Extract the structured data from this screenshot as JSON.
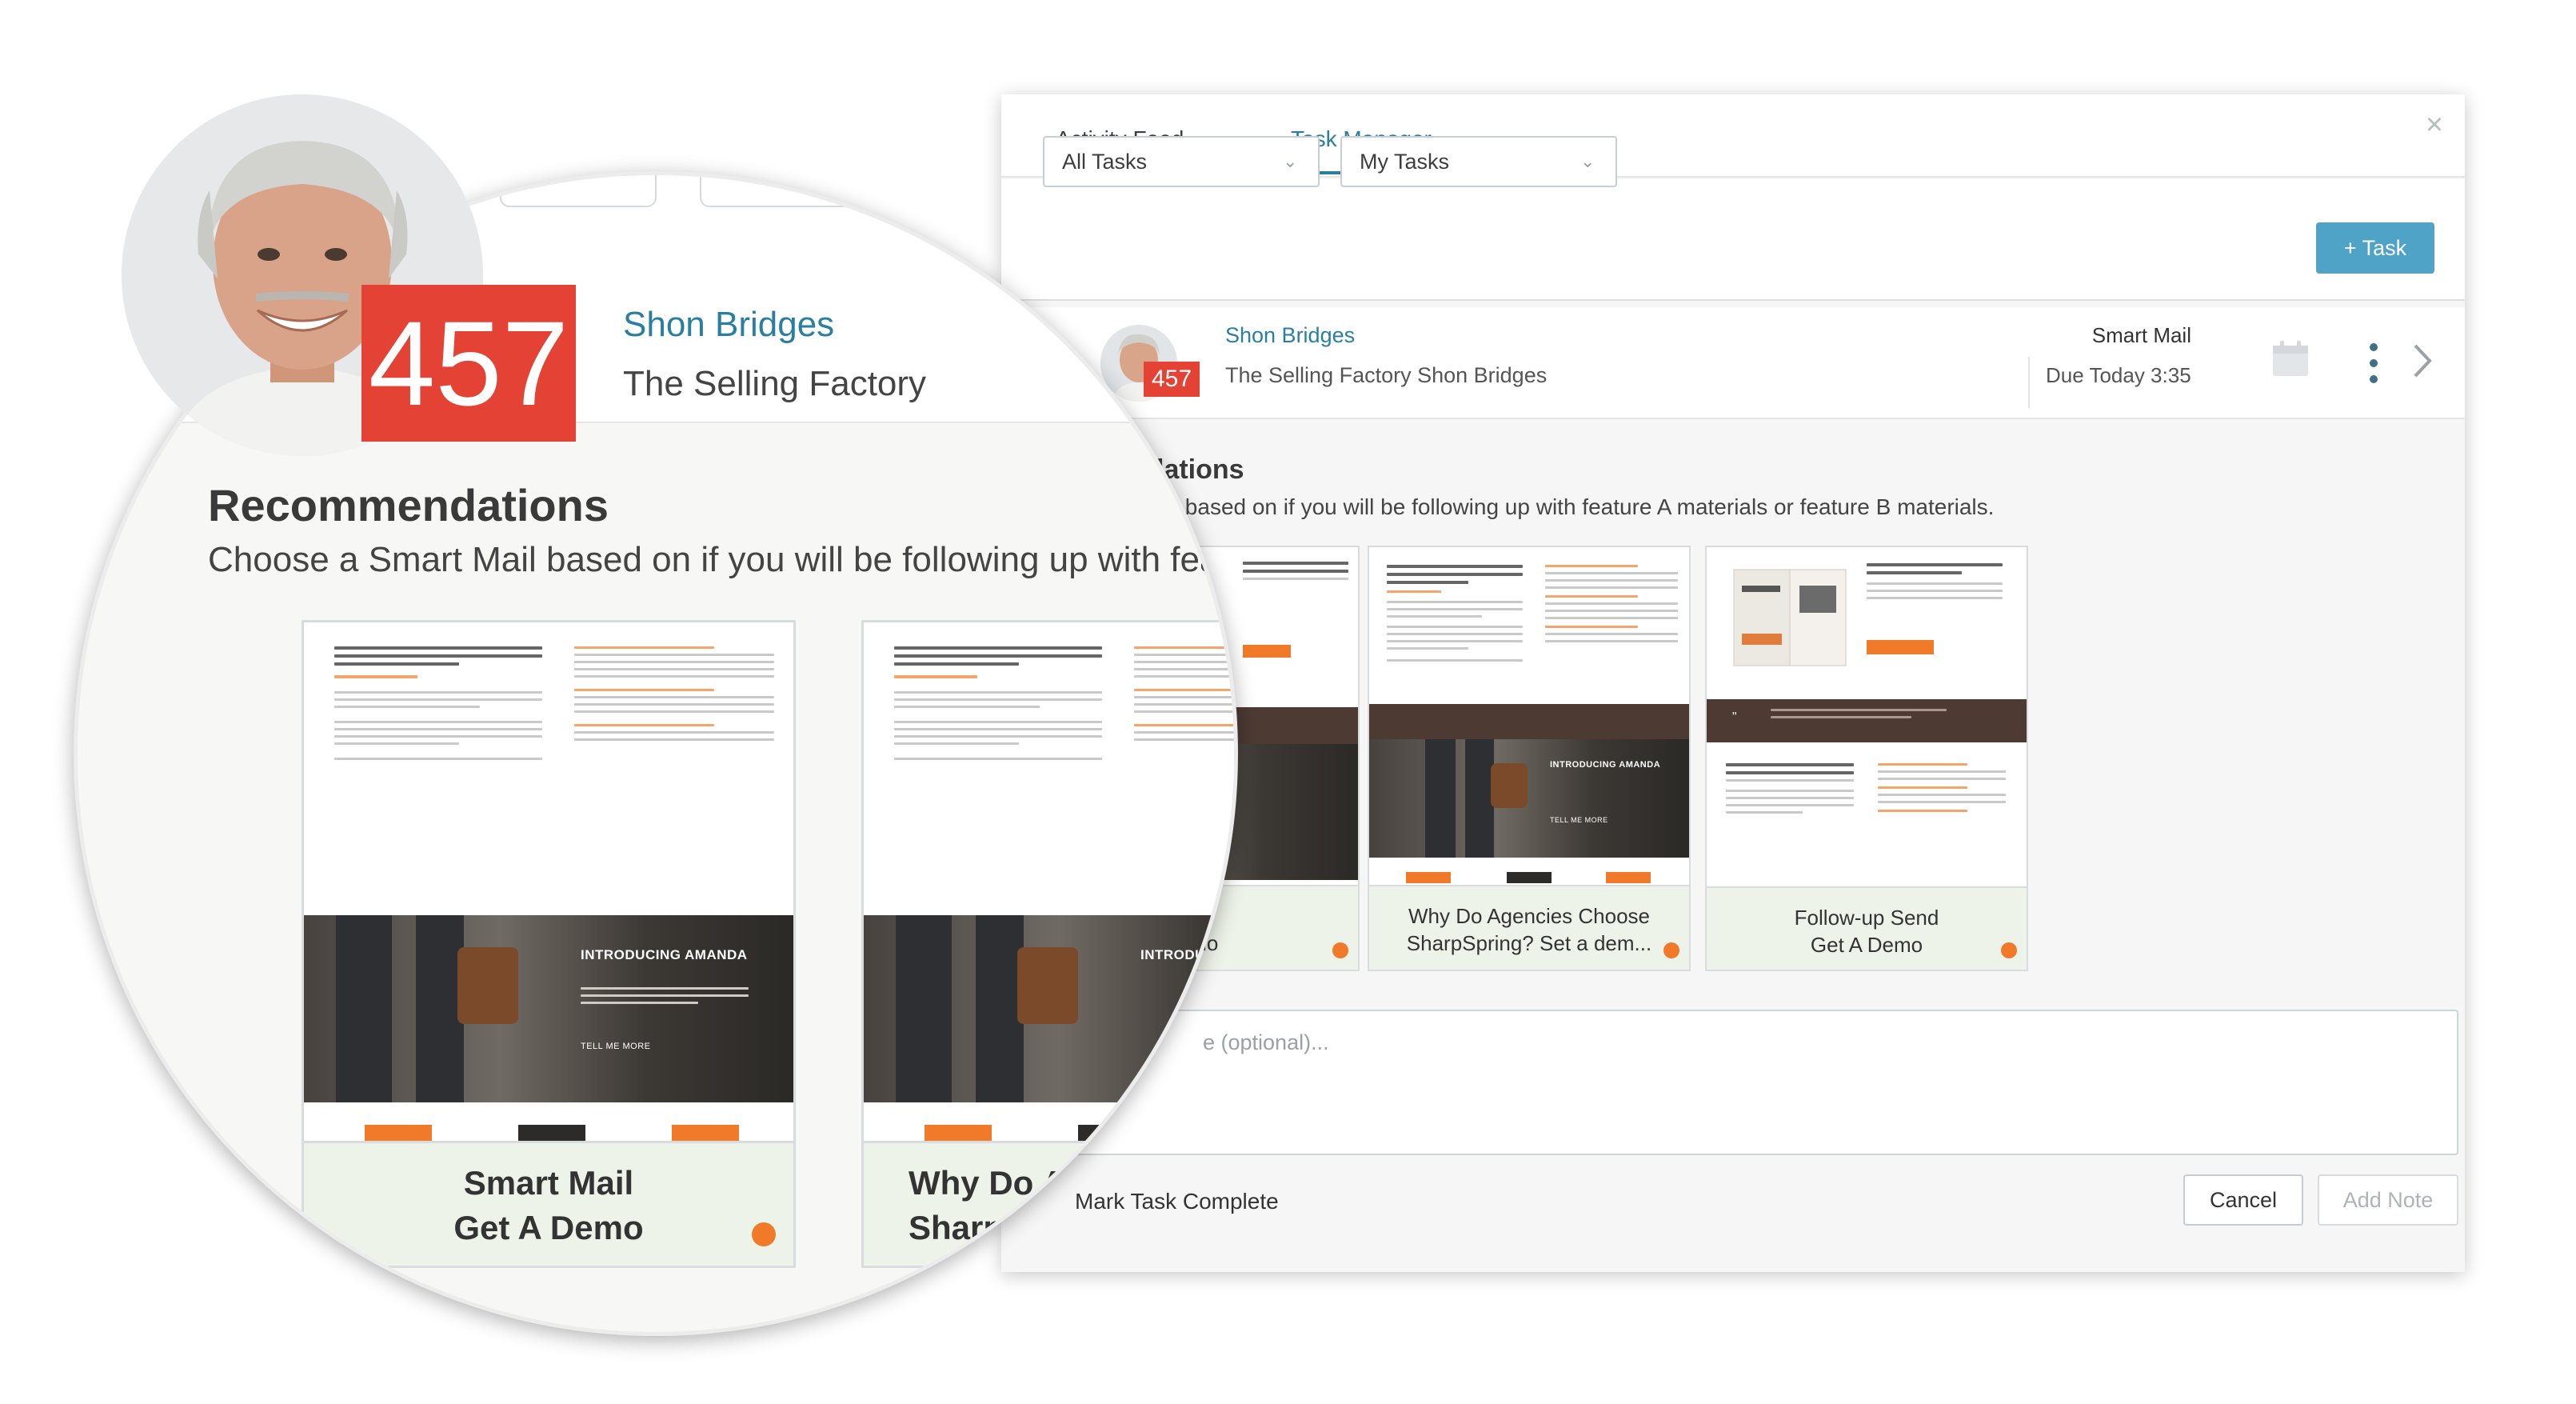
{
  "tabs": [
    {
      "label": "Activity Feed",
      "active": false
    },
    {
      "label": "Task Manager",
      "active": true
    }
  ],
  "filters": {
    "all_tasks": "All Tasks",
    "my_tasks": "My Tasks",
    "add_task": "+ Task"
  },
  "task": {
    "score": "457",
    "contact_name": "Shon Bridges",
    "company_line": "The Selling Factory Shon Bridges",
    "company": "The Selling Factory",
    "type": "Smart Mail",
    "due": "Due Today 3:35"
  },
  "recommendations": {
    "title_partial": "lations",
    "desc_partial": "ail based on if you will be following up with feature A materials or feature B materials.",
    "cards": [
      {
        "line1_partial": "ail",
        "line2_partial": "emo"
      },
      {
        "line1": "Why Do Agencies Choose",
        "line2": "SharpSpring? Set a dem..."
      },
      {
        "line1": "Follow-up Send",
        "line2": "Get A Demo"
      }
    ]
  },
  "note": {
    "placeholder_partial": "e (optional)...",
    "mark_complete": "Mark Task Complete",
    "cancel": "Cancel",
    "add_note": "Add Note"
  },
  "magnified": {
    "score": "457",
    "contact_name": "Shon Bridges",
    "company": "The Selling Factory",
    "rec_title": "Recommendations",
    "rec_desc": "Choose a Smart Mail based on if you will be following up with feature",
    "card1_line1": "Smart Mail",
    "card1_line2": "Get A Demo",
    "card2_line1": "Why Do Ag",
    "card2_line2": "SharpSp"
  },
  "newsletter": {
    "intro": "Mighi is designed with you in mind. We create professional looking newsletters.",
    "amanda": "INTRODUCING AMANDA",
    "tell_more": "TELL ME MORE",
    "book_title": "Get the word out about your new book!",
    "quote": "Use this space for any type of contextual support text to help make a point or build confidence",
    "create_link": "Create amazing emails with ease"
  },
  "colors": {
    "accent_blue": "#2a7ea0",
    "button_blue": "#4fa3c7",
    "badge_red": "#e34234",
    "orange": "#f07a2a",
    "card_footer": "#eef3e9"
  }
}
